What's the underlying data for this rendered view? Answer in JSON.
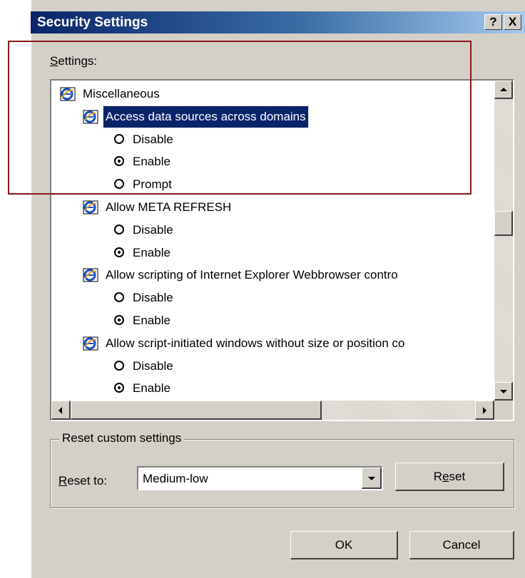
{
  "dialog": {
    "title": "Security Settings",
    "help_button": "?",
    "close_button": "X"
  },
  "settings_label_prefix": "S",
  "settings_label_rest": "ettings:",
  "tree": {
    "root": "Miscellaneous",
    "items": [
      {
        "label": "Access data sources across domains",
        "selected": true,
        "options": [
          {
            "label": "Disable",
            "checked": false
          },
          {
            "label": "Enable",
            "checked": true
          },
          {
            "label": "Prompt",
            "checked": false
          }
        ]
      },
      {
        "label": "Allow META REFRESH",
        "options": [
          {
            "label": "Disable",
            "checked": false
          },
          {
            "label": "Enable",
            "checked": true
          }
        ]
      },
      {
        "label": "Allow scripting of Internet Explorer Webbrowser contro",
        "options": [
          {
            "label": "Disable",
            "checked": false
          },
          {
            "label": "Enable",
            "checked": true
          }
        ]
      },
      {
        "label": "Allow script-initiated windows without size or position co",
        "options": [
          {
            "label": "Disable",
            "checked": false
          },
          {
            "label": "Enable",
            "checked": true
          }
        ]
      }
    ]
  },
  "reset_group": {
    "title": "Reset custom settings",
    "reset_to_prefix": "R",
    "reset_to_rest": "eset to:",
    "selected_level": "Medium-low",
    "reset_button_a": "R",
    "reset_button_u": "e",
    "reset_button_b": "set"
  },
  "buttons": {
    "ok": "OK",
    "cancel": "Cancel"
  },
  "colors": {
    "title_gradient_start": "#0a246a",
    "title_gradient_end": "#a6caf0",
    "dialog_face": "#d4d0c8",
    "selection": "#0a246a",
    "annotation_box": "#8b1a1a"
  }
}
